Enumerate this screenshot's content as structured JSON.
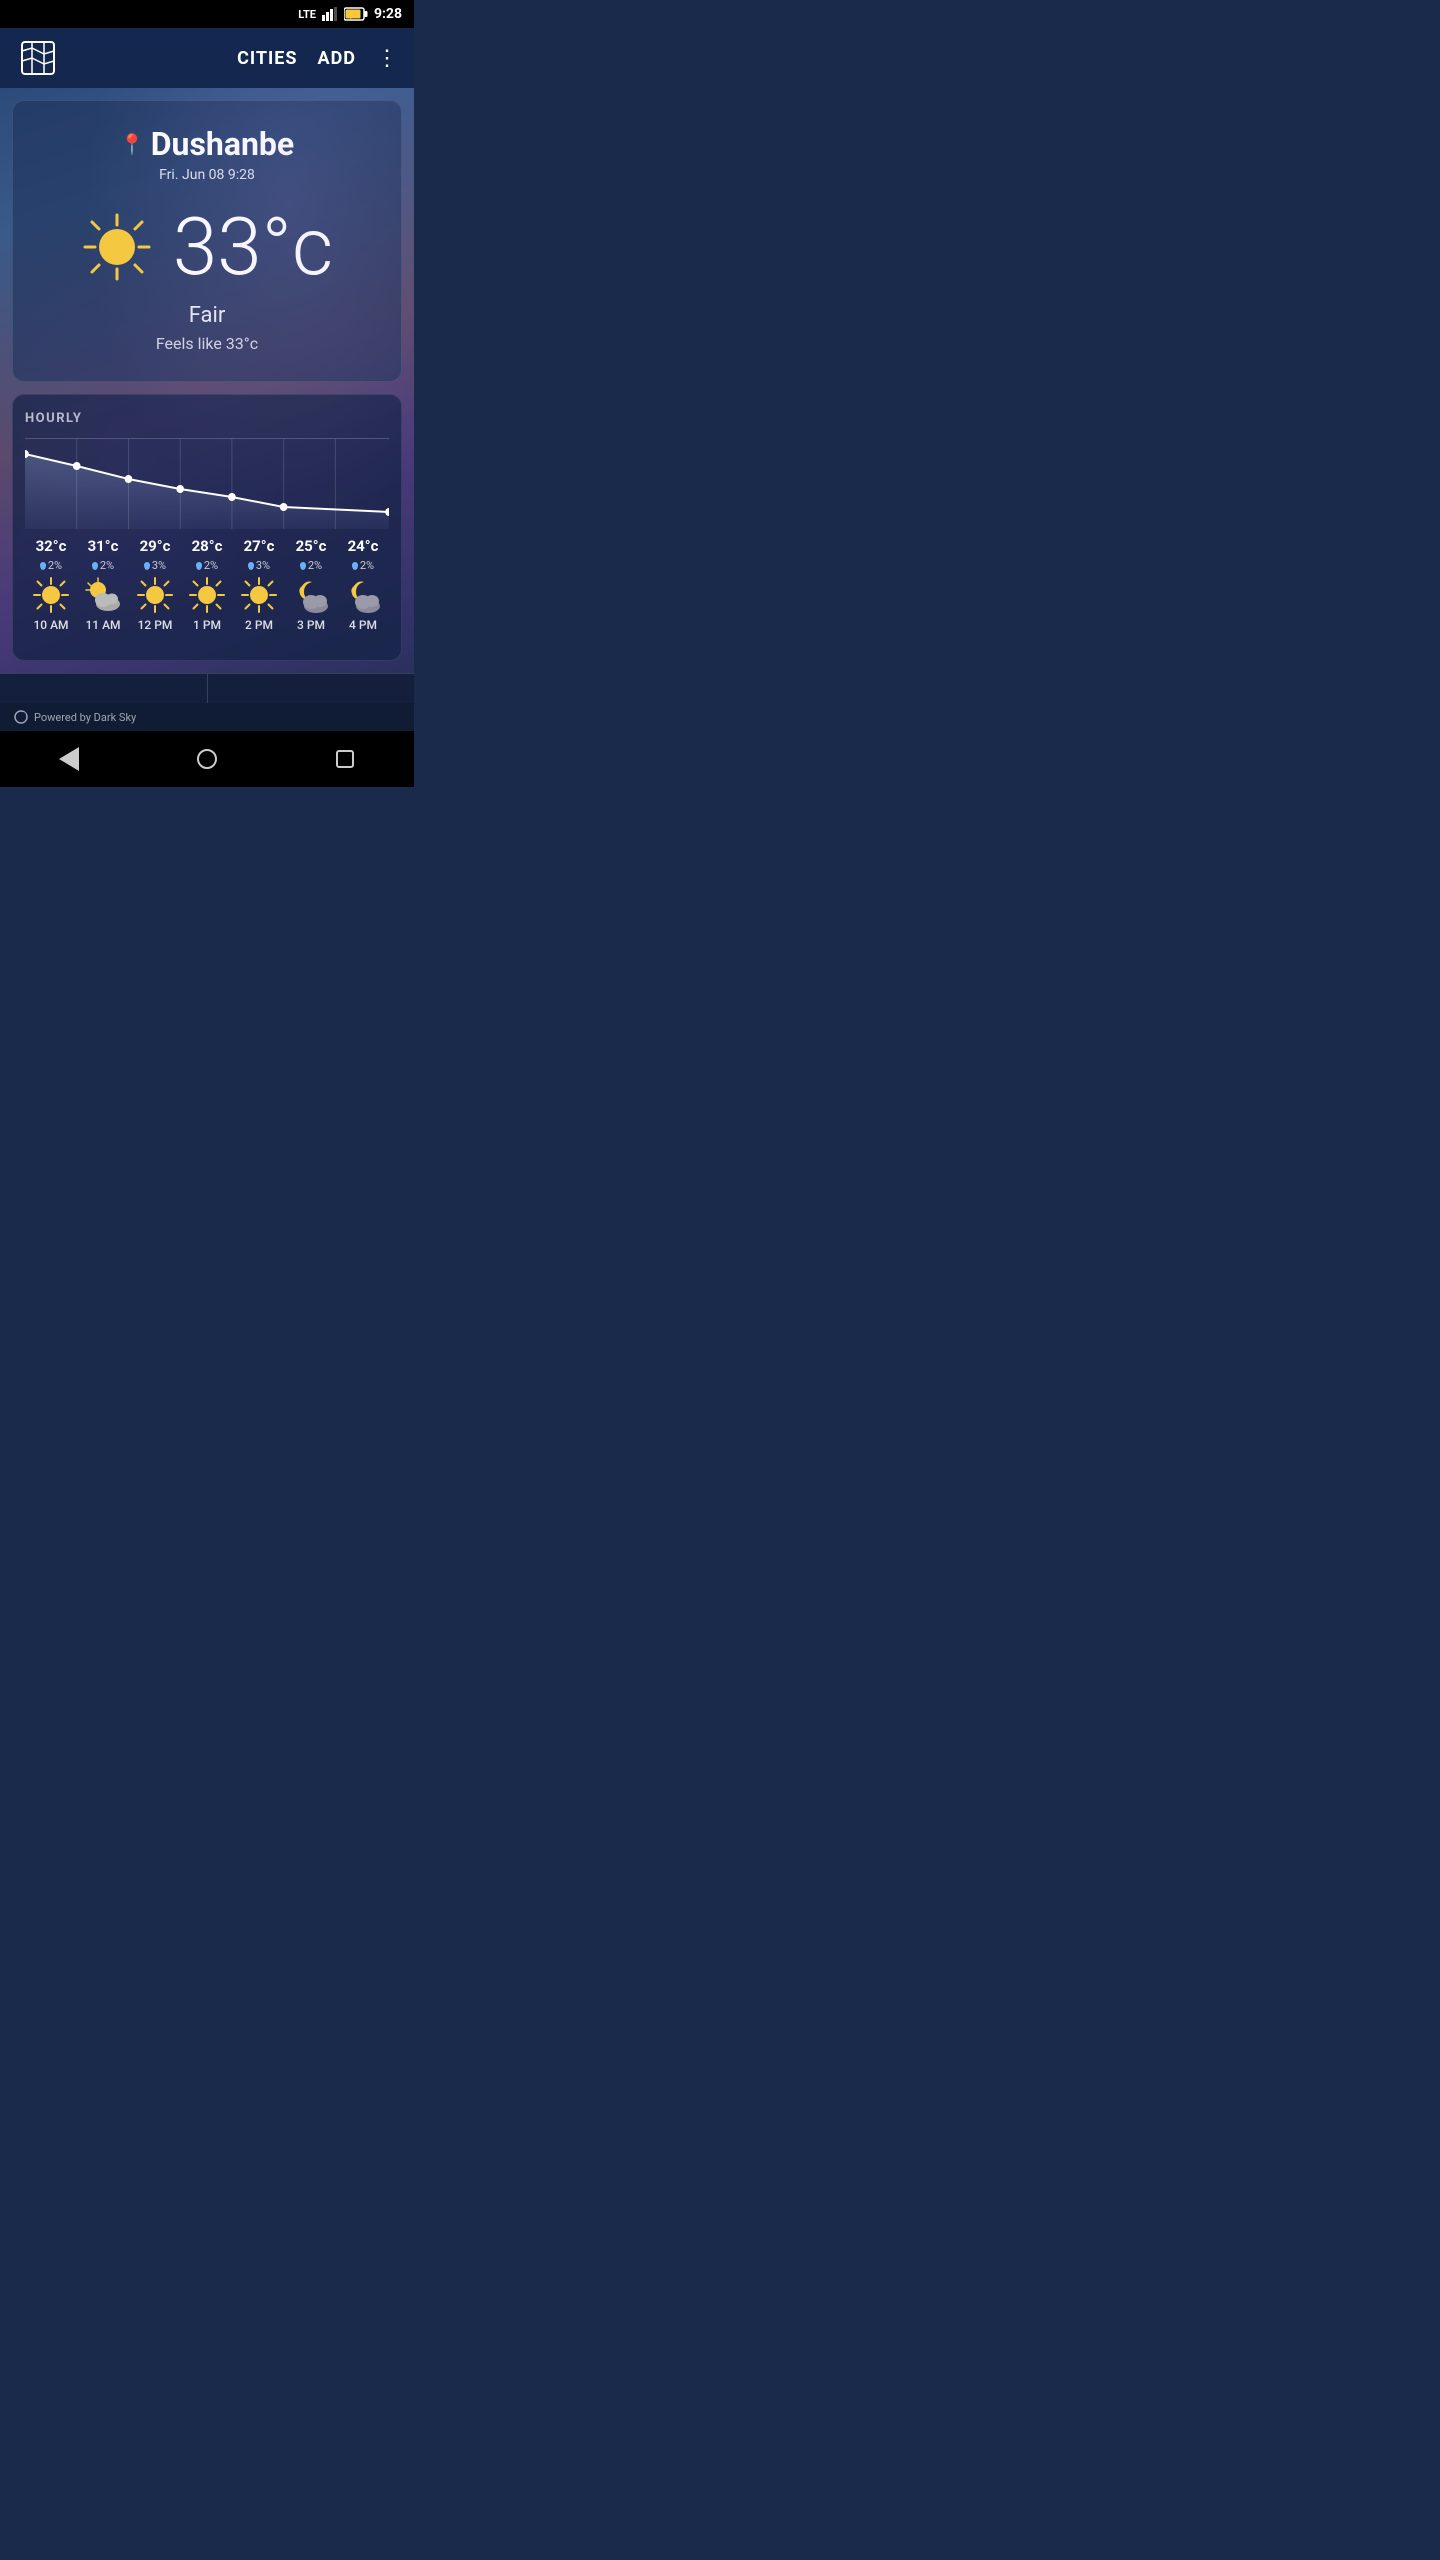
{
  "statusBar": {
    "lte": "LTE",
    "time": "9:28"
  },
  "topNav": {
    "citiesLabel": "CITIES",
    "addLabel": "ADD"
  },
  "currentWeather": {
    "city": "Dushanbe",
    "datetime": "Fri. Jun 08 9:28",
    "temperature": "33°c",
    "condition": "Fair",
    "feelsLike": "Feels like 33°c"
  },
  "hourly": {
    "sectionLabel": "HOURLY",
    "items": [
      {
        "temp": "32°c",
        "precip": "2%",
        "icon": "sun",
        "time": "10 AM"
      },
      {
        "temp": "31°c",
        "precip": "2%",
        "icon": "sun-cloud",
        "time": "11 AM"
      },
      {
        "temp": "29°c",
        "precip": "3%",
        "icon": "sun",
        "time": "12 PM"
      },
      {
        "temp": "28°c",
        "precip": "2%",
        "icon": "sun",
        "time": "1 PM"
      },
      {
        "temp": "27°c",
        "precip": "3%",
        "icon": "sun",
        "time": "2 PM"
      },
      {
        "temp": "25°c",
        "precip": "2%",
        "icon": "moon-cloud",
        "time": "3 PM"
      },
      {
        "temp": "24°c",
        "precip": "2%",
        "icon": "moon-cloud",
        "time": "4 PM"
      }
    ],
    "chart": {
      "points": [
        85,
        72,
        60,
        52,
        42,
        30,
        22
      ]
    }
  },
  "poweredBy": "Powered by Dark Sky"
}
